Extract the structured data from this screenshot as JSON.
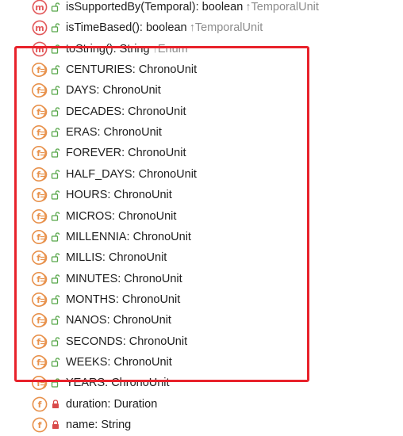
{
  "rows": [
    {
      "kind": "method",
      "access": "public",
      "name": "isSupportedBy(Temporal): boolean",
      "inherit": "↑TemporalUnit"
    },
    {
      "kind": "method",
      "access": "public",
      "name": "isTimeBased(): boolean",
      "inherit": "↑TemporalUnit"
    },
    {
      "kind": "method",
      "access": "public",
      "name": "toString(): String",
      "inherit": "↑Enum"
    },
    {
      "kind": "enum-constant",
      "access": "public",
      "name": "CENTURIES: ChronoUnit"
    },
    {
      "kind": "enum-constant",
      "access": "public",
      "name": "DAYS: ChronoUnit"
    },
    {
      "kind": "enum-constant",
      "access": "public",
      "name": "DECADES: ChronoUnit"
    },
    {
      "kind": "enum-constant",
      "access": "public",
      "name": "ERAS: ChronoUnit"
    },
    {
      "kind": "enum-constant",
      "access": "public",
      "name": "FOREVER: ChronoUnit"
    },
    {
      "kind": "enum-constant",
      "access": "public",
      "name": "HALF_DAYS: ChronoUnit"
    },
    {
      "kind": "enum-constant",
      "access": "public",
      "name": "HOURS: ChronoUnit"
    },
    {
      "kind": "enum-constant",
      "access": "public",
      "name": "MICROS: ChronoUnit"
    },
    {
      "kind": "enum-constant",
      "access": "public",
      "name": "MILLENNIA: ChronoUnit"
    },
    {
      "kind": "enum-constant",
      "access": "public",
      "name": "MILLIS: ChronoUnit"
    },
    {
      "kind": "enum-constant",
      "access": "public",
      "name": "MINUTES: ChronoUnit"
    },
    {
      "kind": "enum-constant",
      "access": "public",
      "name": "MONTHS: ChronoUnit"
    },
    {
      "kind": "enum-constant",
      "access": "public",
      "name": "NANOS: ChronoUnit"
    },
    {
      "kind": "enum-constant",
      "access": "public",
      "name": "SECONDS: ChronoUnit"
    },
    {
      "kind": "enum-constant",
      "access": "public",
      "name": "WEEKS: ChronoUnit"
    },
    {
      "kind": "enum-constant",
      "access": "public",
      "name": "YEARS: ChronoUnit"
    },
    {
      "kind": "field",
      "access": "private",
      "name": "duration: Duration"
    },
    {
      "kind": "field",
      "access": "private",
      "name": "name: String"
    }
  ],
  "icons": {
    "method": "method-icon",
    "enum-constant": "enum-constant-icon",
    "field": "field-icon",
    "public": "unlocked-icon",
    "private": "locked-icon"
  },
  "colors": {
    "icon_red": "#e2585a",
    "icon_orange": "#e8924d",
    "public_green": "#57a64a",
    "private_red": "#d94a4a",
    "inherit_gray": "#8c8c8c",
    "highlight": "#e8222b"
  }
}
